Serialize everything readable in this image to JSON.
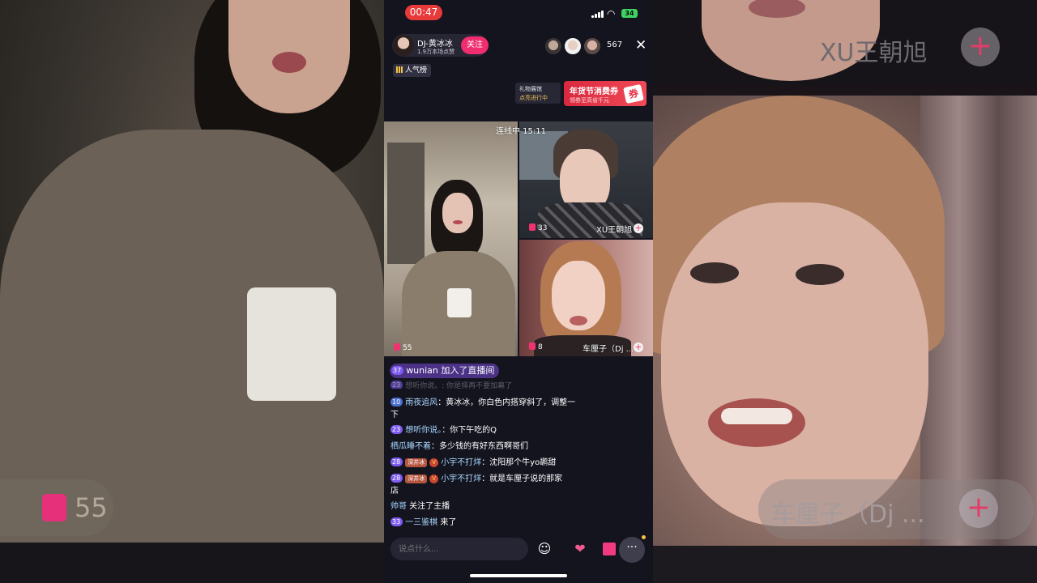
{
  "status_bar": {
    "time": "00:47",
    "battery": "34"
  },
  "host": {
    "name": "DJ-黄冰冰",
    "likes": "1.9万本场点赞",
    "follow_label": "关注"
  },
  "viewer_count": "567",
  "close_label": "✕",
  "rank_label": "人气榜",
  "gift_hall": {
    "line1": "礼物展馆",
    "line2": "点亮进行中"
  },
  "coupon": {
    "title": "年货节消费券",
    "subtitle": "领券至高省千元",
    "tag": "券"
  },
  "connect_label": "连线中 15:11",
  "videos": {
    "main": {
      "gift_count": "55"
    },
    "top_right": {
      "gift_count": "33",
      "name": "XU王朝旭"
    },
    "bottom_right": {
      "gift_count": "8",
      "name": "车厘子（Dj ..."
    }
  },
  "background": {
    "left_gift_count": "55",
    "right_top_name": "XU王朝旭",
    "right_bottom_name": "车厘子（Dj ..."
  },
  "chat": {
    "join": {
      "level": "37",
      "text": "wunian 加入了直播间"
    },
    "faded": {
      "text": "想听你说。: 你是择再不要加幕了"
    },
    "messages": [
      {
        "level": "10",
        "name": "雨夜追风",
        "text": "：黄冰冰，你白色内搭穿斜了，调整一",
        "cont": "下"
      },
      {
        "level": "23",
        "name": "想听你说。",
        "text": "：你下午吃的Q"
      },
      {
        "name": "栖瓜睡不着",
        "text": "：多少钱的有好东西啊哥们"
      },
      {
        "level": "28",
        "fan": "深井冰",
        "vip": "V",
        "name": "小宇不打烊",
        "text": "：沈阳那个牛yo鹕甜"
      },
      {
        "level": "28",
        "fan": "深井冰",
        "vip": "V",
        "name": "小宇不打烊",
        "text": "：就是车厘子说的那家",
        "cont": "店"
      },
      {
        "name": "帅哥",
        "text": " 关注了主播"
      },
      {
        "level": "33",
        "name": "一三鉴棋",
        "text": " 来了"
      }
    ]
  },
  "input": {
    "placeholder": "说点什么..."
  },
  "more_label": "···"
}
